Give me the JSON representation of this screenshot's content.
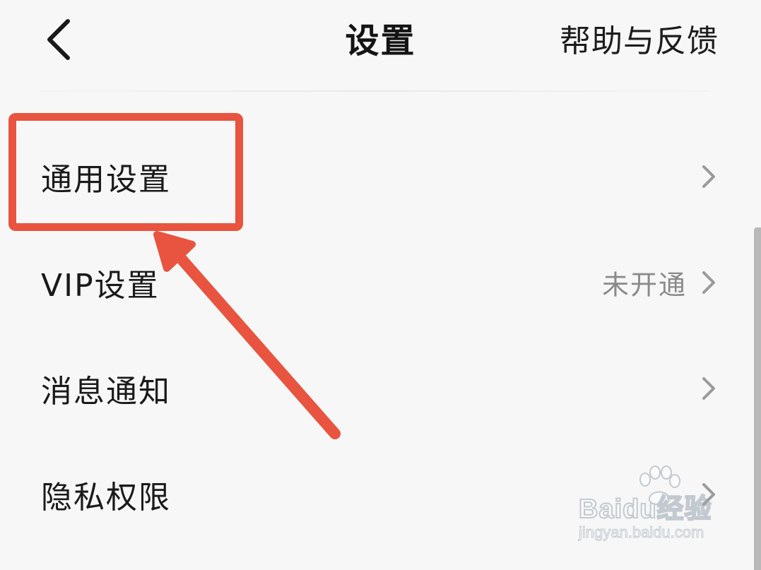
{
  "header": {
    "title": "设置",
    "back_icon": "chevron-left-icon",
    "help_label": "帮助与反馈"
  },
  "settings": {
    "items": [
      {
        "label": "通用设置",
        "value": "",
        "icon": "chevron-right-icon"
      },
      {
        "label": "VIP设置",
        "value": "未开通",
        "icon": "chevron-right-icon"
      },
      {
        "label": "消息通知",
        "value": "",
        "icon": "chevron-right-icon"
      },
      {
        "label": "隐私权限",
        "value": "",
        "icon": "chevron-right-icon"
      }
    ]
  },
  "annotation": {
    "color": "#e8543f",
    "highlighted_item": "通用设置"
  },
  "watermark": {
    "brand": "Baidu经验",
    "url": "jingyan.baidu.com"
  },
  "colors": {
    "background": "#f7f7f7",
    "text": "#1a1a1a",
    "secondary_text": "#8a8a8a",
    "chevron": "#9a9a9a",
    "annotation": "#e8543f"
  }
}
